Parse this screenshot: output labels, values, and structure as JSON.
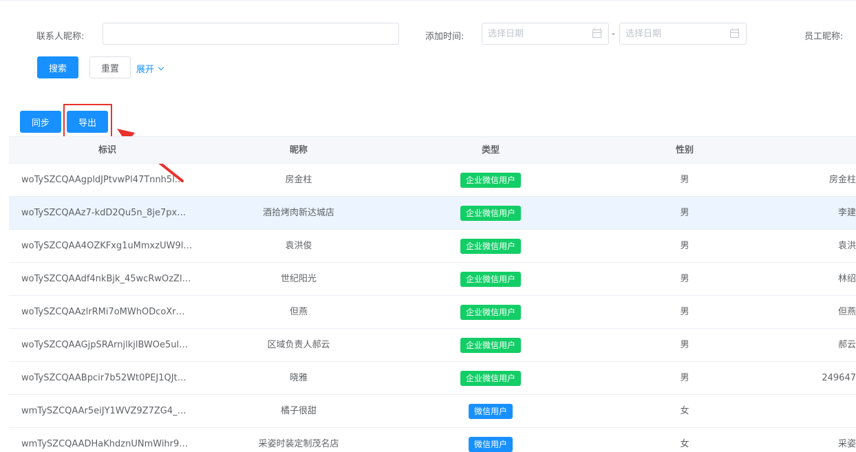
{
  "filters": {
    "contact_label": "联系人昵称:",
    "contact_value": "",
    "time_label": "添加时间:",
    "start_placeholder": "选择日期",
    "end_placeholder": "选择日期",
    "range_sep": "-",
    "staff_label": "员工昵称:"
  },
  "actions": {
    "search": "搜索",
    "reset": "重置",
    "expand": "展开",
    "sync": "同步",
    "export": "导出"
  },
  "table": {
    "columns": [
      "标识",
      "昵称",
      "类型",
      "性别"
    ],
    "rows": [
      {
        "id": "woTySZCQAAgpldJPtvwPl47Tnnh5l…",
        "name": "房金柱",
        "type": "企业微信用户",
        "type_color": "#13ce66",
        "gender": "男",
        "extra": "房金柱"
      },
      {
        "id": "woTySZCQAAz7-kdD2Qu5n_8je7px…",
        "name": "酒拾烤肉新达城店",
        "type": "企业微信用户",
        "type_color": "#13ce66",
        "gender": "男",
        "extra": "李建"
      },
      {
        "id": "woTySZCQAA4OZKFxg1uMmxzUW9l…",
        "name": "袁洪俊",
        "type": "企业微信用户",
        "type_color": "#13ce66",
        "gender": "男",
        "extra": "袁洪"
      },
      {
        "id": "woTySZCQAAdf4nkBjk_45wcRwOzZl…",
        "name": "世纪阳光",
        "type": "企业微信用户",
        "type_color": "#13ce66",
        "gender": "男",
        "extra": "林绍"
      },
      {
        "id": "woTySZCQAAzlrRMi7oMWhODcoXr…",
        "name": "但燕",
        "type": "企业微信用户",
        "type_color": "#13ce66",
        "gender": "男",
        "extra": "但燕"
      },
      {
        "id": "woTySZCQAAGjpSRArnjlkjlBWOe5ul…",
        "name": "区域负责人郝云",
        "type": "企业微信用户",
        "type_color": "#13ce66",
        "gender": "男",
        "extra": "郝云"
      },
      {
        "id": "woTySZCQAABpcir7b52Wt0PEJ1QJt…",
        "name": "晓雅",
        "type": "企业微信用户",
        "type_color": "#13ce66",
        "gender": "男",
        "extra": "249647"
      },
      {
        "id": "wmTySZCQAAr5eiJY1WVZ9Z7ZG4_…",
        "name": "橘子很甜",
        "type": "微信用户",
        "type_color": "#1890ff",
        "gender": "女",
        "extra": ""
      },
      {
        "id": "wmTySZCQAADHaKhdznUNmWihr9…",
        "name": "采姿时装定制茂名店",
        "type": "微信用户",
        "type_color": "#1890ff",
        "gender": "女",
        "extra": "采姿"
      }
    ]
  }
}
